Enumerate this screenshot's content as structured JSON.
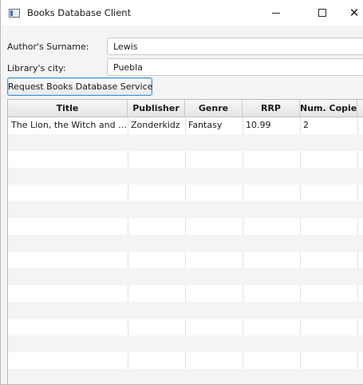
{
  "window": {
    "title": "Books Database Client",
    "close_glyph": "✕"
  },
  "form": {
    "author_label": "Author's Surname:",
    "author_value": "Lewis",
    "city_label": "Library's city:",
    "city_value": "Puebla",
    "request_button": "Request Books Database Service"
  },
  "table": {
    "columns": [
      "Title",
      "Publisher",
      "Genre",
      "RRP",
      "Num. Copies"
    ],
    "rows": [
      [
        "The Lion, the Witch and the Wardrobe",
        "Zonderkidz",
        "Fantasy",
        "10.99",
        "2"
      ]
    ]
  },
  "icons": [
    "app-icon",
    "minimize-icon",
    "maximize-icon",
    "close-icon"
  ]
}
